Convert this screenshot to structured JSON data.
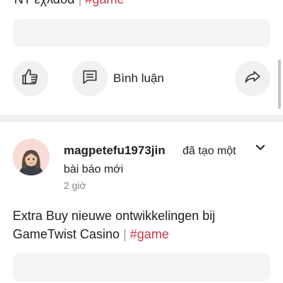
{
  "previous_post": {
    "title_text": "NT εχλάδα",
    "separator": "|",
    "hashtag": "#game"
  },
  "actions": {
    "comment_label": "Bình luận",
    "icons": [
      "thumbs-up-icon",
      "chat-bubble-icon",
      "share-arrow-icon"
    ]
  },
  "post": {
    "author": "magpetefu1973jin",
    "action_line1": "đã tạo một",
    "action_line2": "bài báo mới",
    "time": "2 giờ",
    "body_line1": "Extra Buy nieuwe ontwikkelingen bij",
    "body_line2_text": "GameTwist Casino",
    "separator": "|",
    "hashtag": "#game"
  },
  "colors": {
    "hashtag": "#c2394a",
    "surface": "#f1f1f1",
    "avatar_bg": "#f7dcd6"
  }
}
